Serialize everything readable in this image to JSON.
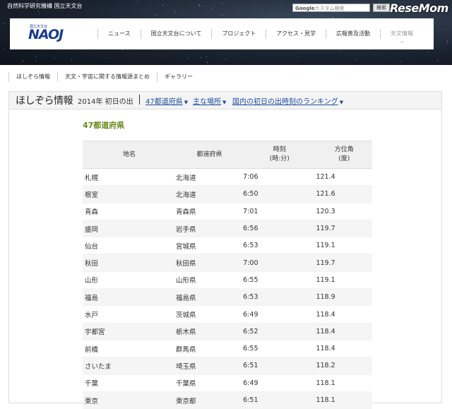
{
  "header": {
    "org_label": "自然科学研究機構 国立天文台",
    "search_brand": "Google",
    "search_placeholder": "カスタム検索",
    "search_button": "検索",
    "watermark": "ReseMom",
    "logo_small": "国立天文台",
    "logo_text": "NAOJ",
    "nav": [
      {
        "label": "ニュース"
      },
      {
        "label": "国立天文台について"
      },
      {
        "label": "プロジェクト"
      },
      {
        "label": "アクセス・見学"
      },
      {
        "label": "広報普及活動"
      },
      {
        "label": "天文情報"
      }
    ],
    "active_nav_caret": "^"
  },
  "subnav": [
    {
      "label": "ほしぞら情報"
    },
    {
      "label": "天文・宇宙に関する情報源まとめ"
    },
    {
      "label": "ギャラリー"
    }
  ],
  "panel": {
    "title": "ほしぞら情報",
    "date_label": "2014年 初日の出",
    "dropdowns": [
      {
        "label": "47都道府県"
      },
      {
        "label": "主な場所"
      },
      {
        "label": "国内の初日の出時刻のランキング"
      }
    ],
    "section_title": "47都道府県"
  },
  "table": {
    "headers": [
      {
        "line1": "地名",
        "line2": ""
      },
      {
        "line1": "都道府県",
        "line2": ""
      },
      {
        "line1": "時刻",
        "line2": "(時:分)"
      },
      {
        "line1": "方位角",
        "line2": "(度)"
      }
    ],
    "rows": [
      [
        "札幌",
        "北海道",
        "7:06",
        "121.4"
      ],
      [
        "根室",
        "北海道",
        "6:50",
        "121.6"
      ],
      [
        "青森",
        "青森県",
        "7:01",
        "120.3"
      ],
      [
        "盛岡",
        "岩手県",
        "6:56",
        "119.7"
      ],
      [
        "仙台",
        "宮城県",
        "6:53",
        "119.1"
      ],
      [
        "秋田",
        "秋田県",
        "7:00",
        "119.7"
      ],
      [
        "山形",
        "山形県",
        "6:55",
        "119.1"
      ],
      [
        "福島",
        "福島県",
        "6:53",
        "118.9"
      ],
      [
        "水戸",
        "茨城県",
        "6:49",
        "118.4"
      ],
      [
        "宇都宮",
        "栃木県",
        "6:52",
        "118.4"
      ],
      [
        "前橋",
        "群馬県",
        "6:55",
        "118.4"
      ],
      [
        "さいたま",
        "埼玉県",
        "6:51",
        "118.2"
      ],
      [
        "千葉",
        "千葉県",
        "6:49",
        "118.1"
      ],
      [
        "東京",
        "東京都",
        "6:51",
        "118.1"
      ]
    ]
  },
  "colors": {
    "accent_link": "#1e4e9c",
    "section_title": "#6a8b1e",
    "brand": "#1a3c8c"
  }
}
